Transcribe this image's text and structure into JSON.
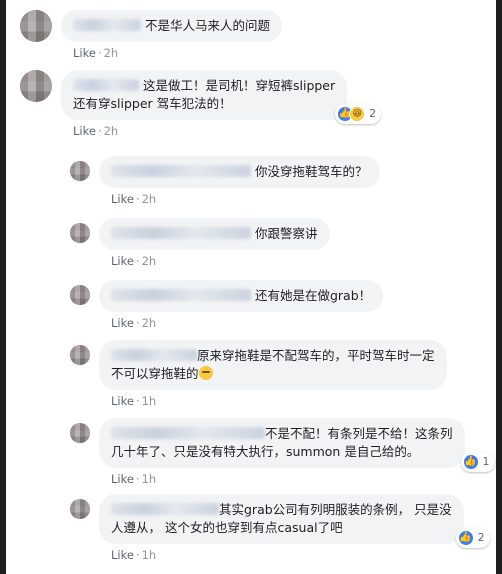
{
  "comments": [
    {
      "text": "不是华人马来人的问题",
      "like": "Like",
      "time": "2h"
    },
    {
      "line1": "这是做工！是司机！穿短裤slipper",
      "line2": "还有穿slipper 驾车犯法的！",
      "like": "Like",
      "time": "2h",
      "reaction_count": "2"
    }
  ],
  "replies": [
    {
      "text": "你没穿拖鞋驾车的？",
      "like": "Like",
      "time": "2h"
    },
    {
      "text": "你跟警察讲",
      "like": "Like",
      "time": "2h"
    },
    {
      "text": "还有她是在做grab！",
      "like": "Like",
      "time": "2h"
    },
    {
      "line1": "原来穿拖鞋是不配驾车的，平时驾车时一定",
      "line2": "不可以穿拖鞋的",
      "like": "Like",
      "time": "1h"
    },
    {
      "line1": "不是不配！有条列是不给！这条列",
      "line2": "几十年了、只是没有特大执行，summon 是自己给的。",
      "like": "Like",
      "time": "1h",
      "reaction_count": "1"
    },
    {
      "line1": "其实grab公司有列明服装的条例， 只是没",
      "line2": "人遵从， 这个女的也穿到有点casual了吧",
      "like": "Like",
      "time": "1h",
      "reaction_count": "2"
    }
  ],
  "icons": {
    "like_reaction": "like-reaction-icon",
    "haha_reaction": "haha-reaction-icon",
    "thinking_emoji": "thinking-emoji-icon"
  },
  "colors": {
    "bubble_bg": "#f2f3f5",
    "meta_text": "#90949c",
    "like_blue": "#3b7bf5"
  }
}
